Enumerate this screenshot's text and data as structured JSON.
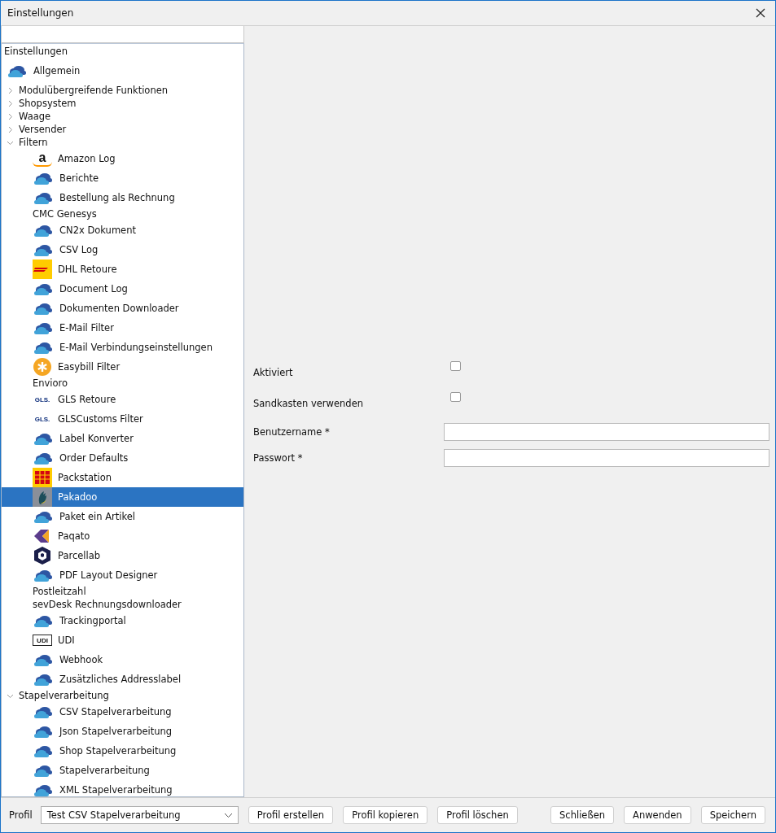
{
  "window": {
    "title": "Einstellungen"
  },
  "tree": {
    "label": "Einstellungen",
    "selected": false,
    "children": [
      {
        "label": "Allgemein",
        "kind": "cloud",
        "selected": false
      },
      {
        "label": "Modulübergreifende Funktionen",
        "expanded": false,
        "selected": false
      },
      {
        "label": "Shopsystem",
        "expanded": false,
        "selected": false
      },
      {
        "label": "Waage",
        "expanded": false,
        "selected": false
      },
      {
        "label": "Versender",
        "expanded": false,
        "selected": false
      },
      {
        "label": "Filtern",
        "expanded": true,
        "selected": false,
        "children": [
          {
            "label": "Amazon Log",
            "kind": "amazon",
            "logo_text": "a",
            "selected": false
          },
          {
            "label": "Berichte",
            "kind": "cloud",
            "selected": false
          },
          {
            "label": "Bestellung als Rechnung",
            "kind": "cloud",
            "selected": false
          },
          {
            "label": "CMC Genesys",
            "selected": false
          },
          {
            "label": "CN2x Dokument",
            "kind": "cloud",
            "selected": false
          },
          {
            "label": "CSV Log",
            "kind": "cloud",
            "selected": false
          },
          {
            "label": "DHL Retoure",
            "kind": "dhl",
            "selected": false
          },
          {
            "label": "Document Log",
            "kind": "cloud",
            "selected": false
          },
          {
            "label": "Dokumenten Downloader",
            "kind": "cloud",
            "selected": false
          },
          {
            "label": "E-Mail Filter",
            "kind": "cloud",
            "selected": false
          },
          {
            "label": "E-Mail Verbindungseinstellungen",
            "kind": "cloud",
            "selected": false
          },
          {
            "label": "Easybill Filter",
            "kind": "easybill",
            "selected": false
          },
          {
            "label": "Envioro",
            "selected": false
          },
          {
            "label": "GLS Retoure",
            "kind": "gls",
            "logo_text": "GLS.",
            "selected": false
          },
          {
            "label": "GLSCustoms Filter",
            "kind": "gls",
            "logo_text": "GLS.",
            "selected": false
          },
          {
            "label": "Label Konverter",
            "kind": "cloud",
            "selected": false
          },
          {
            "label": "Order Defaults",
            "kind": "cloud",
            "selected": false
          },
          {
            "label": "Packstation",
            "kind": "packstation",
            "selected": false
          },
          {
            "label": "Pakadoo",
            "kind": "pakadoo",
            "selected": true
          },
          {
            "label": "Paket ein Artikel",
            "kind": "cloud",
            "selected": false
          },
          {
            "label": "Paqato",
            "kind": "paqato",
            "selected": false
          },
          {
            "label": "Parcellab",
            "kind": "parcellab",
            "selected": false
          },
          {
            "label": "PDF Layout Designer",
            "kind": "cloud",
            "selected": false
          },
          {
            "label": "Postleitzahl",
            "selected": false
          },
          {
            "label": "sevDesk Rechnungsdownloader",
            "selected": false
          },
          {
            "label": "Trackingportal",
            "kind": "cloud",
            "selected": false
          },
          {
            "label": "UDI",
            "kind": "udi",
            "logo_text": "UDI",
            "selected": false
          },
          {
            "label": "Webhook",
            "kind": "cloud",
            "selected": false
          },
          {
            "label": "Zusätzliches Addresslabel",
            "kind": "cloud",
            "selected": false
          }
        ]
      },
      {
        "label": "Stapelverarbeitung",
        "expanded": true,
        "selected": false,
        "children": [
          {
            "label": "CSV Stapelverarbeitung",
            "kind": "cloud",
            "selected": false
          },
          {
            "label": "Json Stapelverarbeitung",
            "kind": "cloud",
            "selected": false
          },
          {
            "label": "Shop Stapelverarbeitung",
            "kind": "cloud",
            "selected": false
          },
          {
            "label": "Stapelverarbeitung",
            "kind": "cloud",
            "selected": false
          },
          {
            "label": "XML Stapelverarbeitung",
            "kind": "cloud",
            "selected": false
          }
        ]
      }
    ]
  },
  "form": [
    {
      "label": "Aktiviert",
      "kind": "checkbox",
      "checked": false
    },
    {
      "label": "Sandkasten verwenden",
      "kind": "checkbox",
      "checked": false
    },
    {
      "label": "Benutzername *",
      "kind": "text"
    },
    {
      "label": "Passwort *",
      "kind": "text"
    }
  ],
  "profile": {
    "label": "Profil",
    "value": "Test CSV Stapelverarbeitung"
  },
  "profile_buttons": [
    "Profil erstellen",
    "Profil kopieren",
    "Profil löschen"
  ],
  "dialog_buttons": [
    "Schließen",
    "Anwenden",
    "Speichern"
  ]
}
